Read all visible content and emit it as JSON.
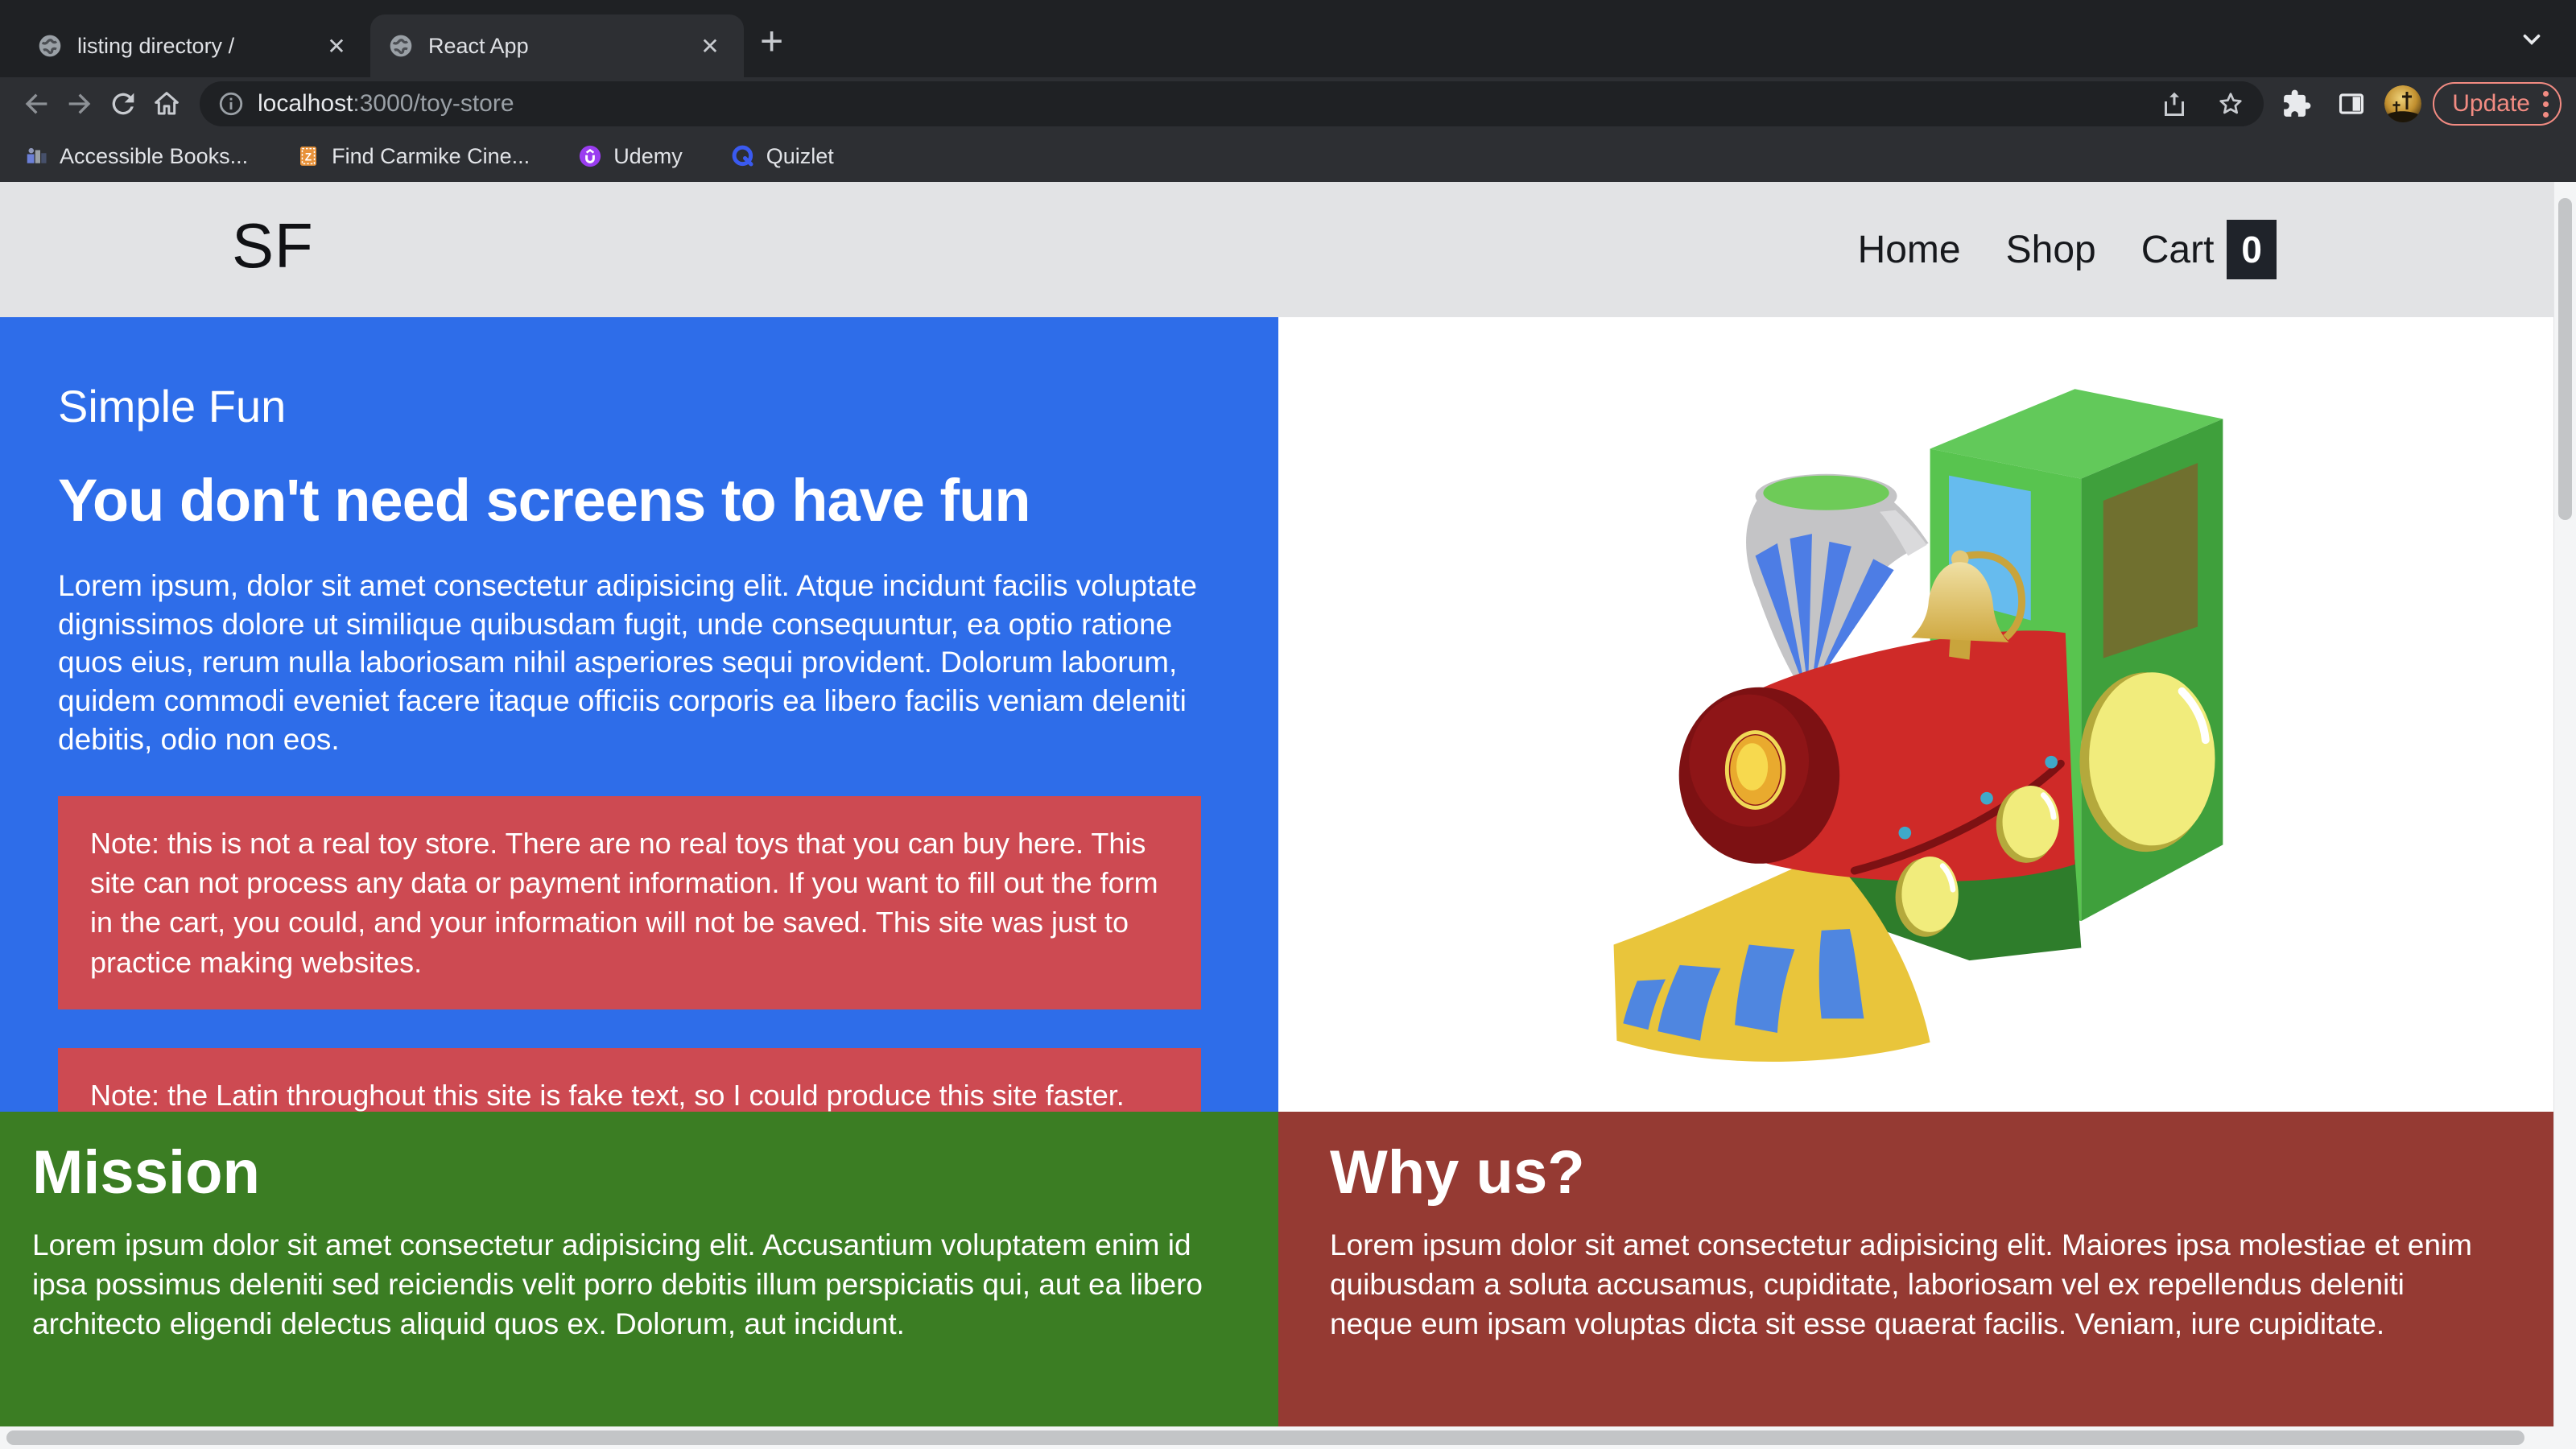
{
  "browser": {
    "tabs": [
      {
        "title": "listing directory /"
      },
      {
        "title": "React App"
      }
    ],
    "url_host": "localhost",
    "url_rest": ":3000/toy-store",
    "update_label": "Update",
    "bookmarks": [
      {
        "label": "Accessible Books..."
      },
      {
        "label": "Find Carmike Cine..."
      },
      {
        "label": "Udemy"
      },
      {
        "label": "Quizlet"
      }
    ]
  },
  "site": {
    "logo": "SF",
    "nav": {
      "home": "Home",
      "shop": "Shop",
      "cart": "Cart",
      "cart_count": "0"
    },
    "hero": {
      "kicker": "Simple Fun",
      "title": "You don't need screens to have fun",
      "body": "Lorem ipsum, dolor sit amet consectetur adipisicing elit. Atque incidunt facilis voluptate dignissimos dolore ut similique quibusdam fugit, unde consequuntur, ea optio ratione quos eius, rerum nulla laboriosam nihil asperiores sequi provident. Dolorum laborum, quidem commodi eveniet facere itaque officiis corporis ea libero facilis veniam deleniti debitis, odio non eos.",
      "notes": [
        "Note: this is not a real toy store. There are no real toys that you can buy here. This site can not process any data or payment information. If you want to fill out the form in the cart, you could, and your information will not be saved. This site was just to practice making websites.",
        "Note: the Latin throughout this site is fake text, so I could produce this site faster."
      ]
    },
    "mission": {
      "title": "Mission",
      "body": "Lorem ipsum dolor sit amet consectetur adipisicing elit. Accusantium voluptatem enim id ipsa possimus deleniti sed reiciendis velit porro debitis illum perspiciatis qui, aut ea libero architecto eligendi delectus aliquid quos ex. Dolorum, aut incidunt."
    },
    "why": {
      "title": "Why us?",
      "body": "Lorem ipsum dolor sit amet consectetur adipisicing elit. Maiores ipsa molestiae et enim quibusdam a soluta accusamus, cupiditate, laboriosam vel ex repellendus deleniti neque eum ipsam voluptas dicta sit esse quaerat facilis. Veniam, iure cupiditate."
    },
    "colors": {
      "hero_blue": "#2e6de9",
      "note_red": "#cd4a52",
      "mission_green": "#3b7d23",
      "why_maroon": "#953a33",
      "update_pink": "#f28b82",
      "header_gray": "#e2e3e5"
    }
  }
}
